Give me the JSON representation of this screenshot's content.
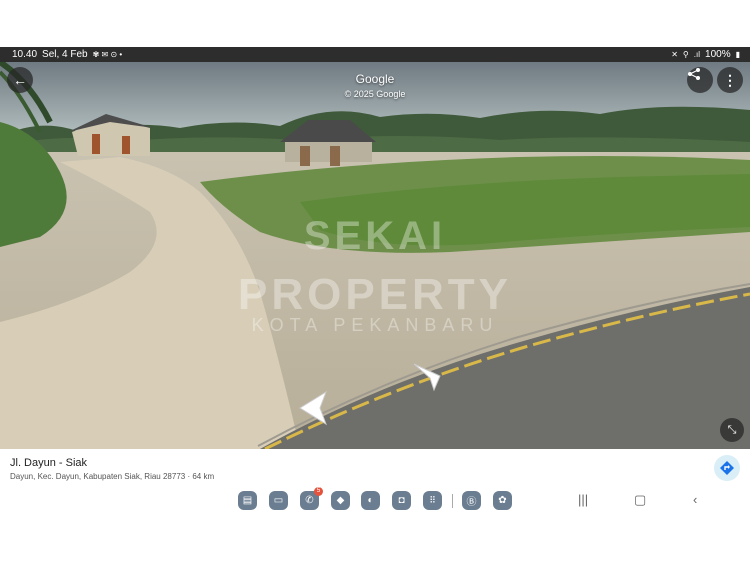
{
  "status_bar": {
    "time": "10.40",
    "date": "Sel, 4 Feb",
    "battery": "100%"
  },
  "header": {
    "title": "Google",
    "copyright": "© 2025 Google"
  },
  "watermark": {
    "line1": "SEKAI",
    "line2": "PROPERTY",
    "line3": "KOTA PEKANBARU"
  },
  "location": {
    "name": "Jl. Dayun - Siak",
    "address": "Dayun, Kec. Dayun, Kabupaten Siak, Riau 28773 · 64 km"
  },
  "dock": {
    "badge_count": "5"
  },
  "colors": {
    "status_bg": "#2d2d2d",
    "badge": "#e5533d",
    "directions_bg": "#d9eef7",
    "directions_icon": "#1a73e8"
  }
}
